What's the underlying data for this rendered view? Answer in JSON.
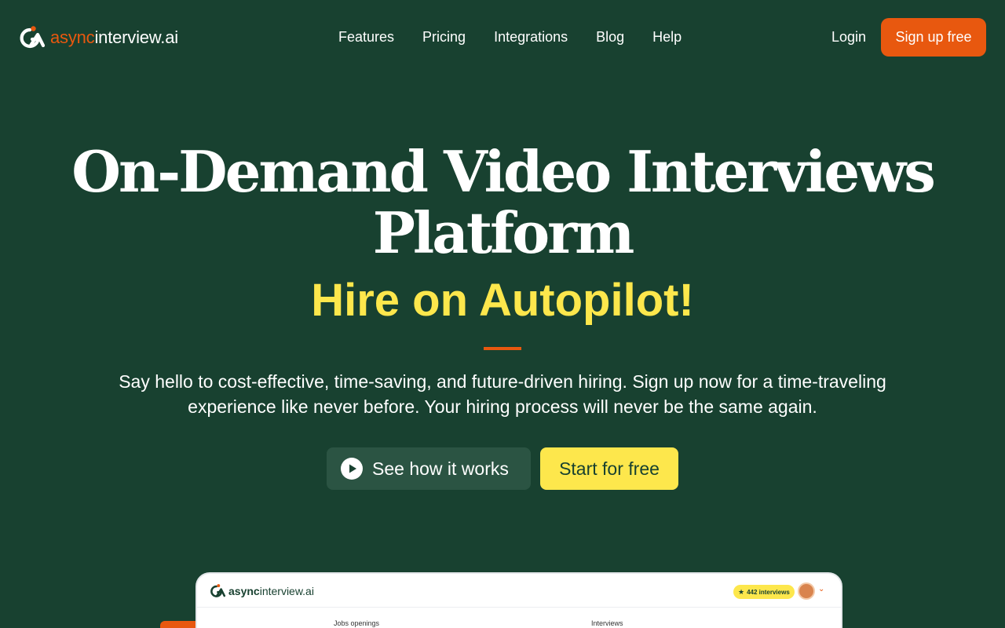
{
  "brand": {
    "logo_async": "async",
    "logo_rest": "interview.ai",
    "accent": "#e8580f",
    "highlight": "#fde74c",
    "background": "#184130"
  },
  "nav": {
    "links": [
      "Features",
      "Pricing",
      "Integrations",
      "Blog",
      "Help"
    ],
    "login": "Login",
    "signup": "Sign up free"
  },
  "hero": {
    "title_line1": "On-Demand Video Interviews",
    "title_line2": "Platform",
    "subtitle": "Hire on Autopilot!",
    "description": "Say hello to cost-effective, time-saving, and future-driven hiring. Sign up now for a time-traveling experience like never before. Your hiring process will never be the same again.",
    "cta_secondary": "See how it works",
    "cta_secondary_icon": "play-icon",
    "cta_primary": "Start for free"
  },
  "preview": {
    "logo_async": "async",
    "logo_rest": "interview.ai",
    "badge": "442 interviews",
    "badge_icon": "star-icon",
    "col_jobs": "Jobs openings",
    "col_interviews": "Interviews"
  }
}
